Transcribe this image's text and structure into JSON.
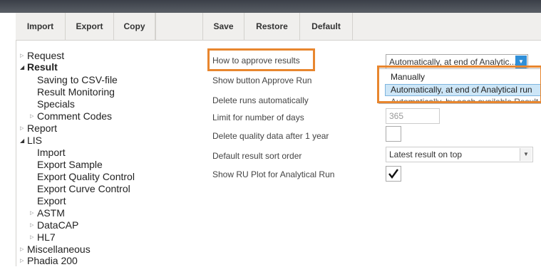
{
  "toolbar": {
    "buttons": [
      "Import",
      "Export",
      "Copy",
      "Save",
      "Restore",
      "Default"
    ]
  },
  "tree": {
    "items": [
      "Request",
      "Result",
      "Saving to CSV-file",
      "Result Monitoring",
      "Specials",
      "Comment Codes",
      "Report",
      "LIS",
      "Import",
      "Export Sample",
      "Export Quality Control",
      "Export Curve Control",
      "Export",
      "ASTM",
      "DataCAP",
      "HL7",
      "Miscellaneous",
      "Phadia 200"
    ]
  },
  "settings": {
    "labels": [
      "How to approve results",
      "Show button Approve Run",
      "Delete runs automatically",
      "Limit for number of days",
      "Delete quality data after 1 year",
      "Default result sort order",
      "Show RU Plot for Analytical Run"
    ],
    "approve_value": "Automatically, at end of Analytic...",
    "approve_options": [
      "Manually",
      "Automatically, at end of Analytical run",
      "Automatically, by each available Result"
    ],
    "limit_days_value": "365",
    "sort_order_value": "Latest result on top",
    "delete_quality_checked": false,
    "ru_plot_checked": true
  },
  "colors": {
    "highlight": "#e8862e",
    "selection": "#cde6f7",
    "accent": "#2f8fd8"
  }
}
